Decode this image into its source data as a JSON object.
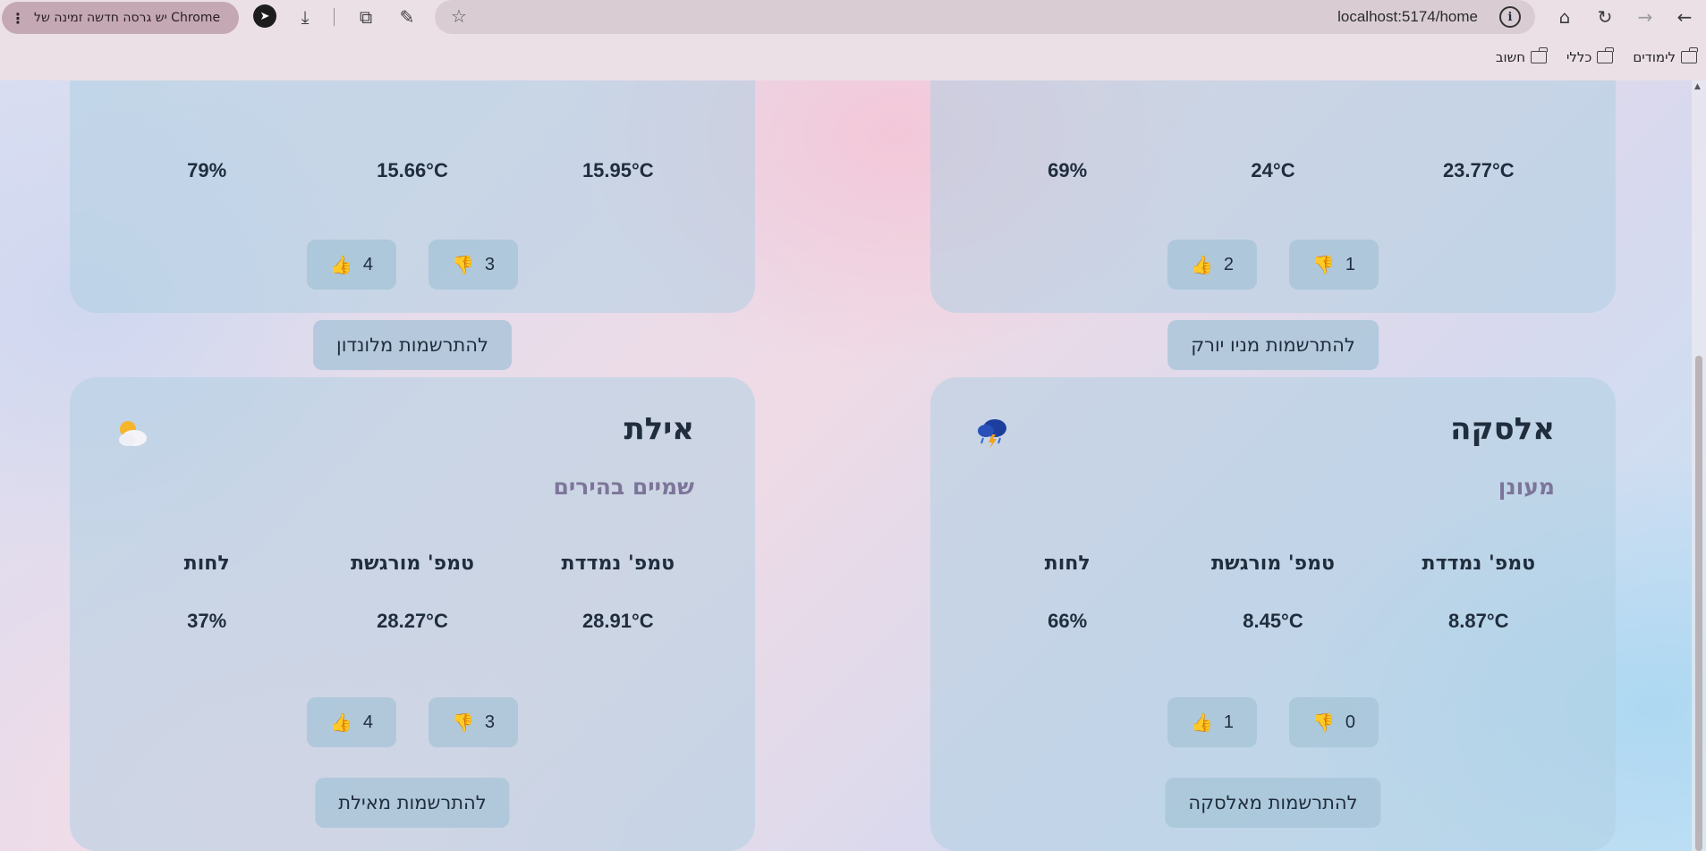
{
  "browser": {
    "update_notice": "יש גרסה חדשה זמינה של Chrome",
    "url": "localhost:5174/home",
    "bookmarks": [
      "לימודים",
      "כללי",
      "חשוב"
    ]
  },
  "cards_top": [
    {
      "id": "london",
      "humidity": "79%",
      "feels_like": "15.66°C",
      "measured": "15.95°C",
      "likes": "4",
      "dislikes": "3",
      "register_label": "להתרשמות מלונדון"
    },
    {
      "id": "new-york",
      "humidity": "69%",
      "feels_like": "24°C",
      "measured": "23.77°C",
      "likes": "2",
      "dislikes": "1",
      "register_label": "להתרשמות מניו יורק"
    }
  ],
  "cards_bottom": [
    {
      "id": "eilat",
      "city": "אילת",
      "description": "שמיים בהירים",
      "icon": "partly-cloudy-icon",
      "labels": {
        "measured": "טמפ' נמדדת",
        "feels_like": "טמפ' מורגשת",
        "humidity": "לחות"
      },
      "measured": "28.91°C",
      "feels_like": "28.27°C",
      "humidity": "37%",
      "likes": "4",
      "dislikes": "3",
      "register_label": "להתרשמות מאילת"
    },
    {
      "id": "alaska",
      "city": "אלסקה",
      "description": "מעונן",
      "icon": "thunderstorm-icon",
      "labels": {
        "measured": "טמפ' נמדדת",
        "feels_like": "טמפ' מורגשת",
        "humidity": "לחות"
      },
      "measured": "8.87°C",
      "feels_like": "8.45°C",
      "humidity": "66%",
      "likes": "1",
      "dislikes": "0",
      "register_label": "להתרשמות מאלסקה"
    }
  ],
  "icons": {
    "like": "👍",
    "dislike": "👎"
  }
}
